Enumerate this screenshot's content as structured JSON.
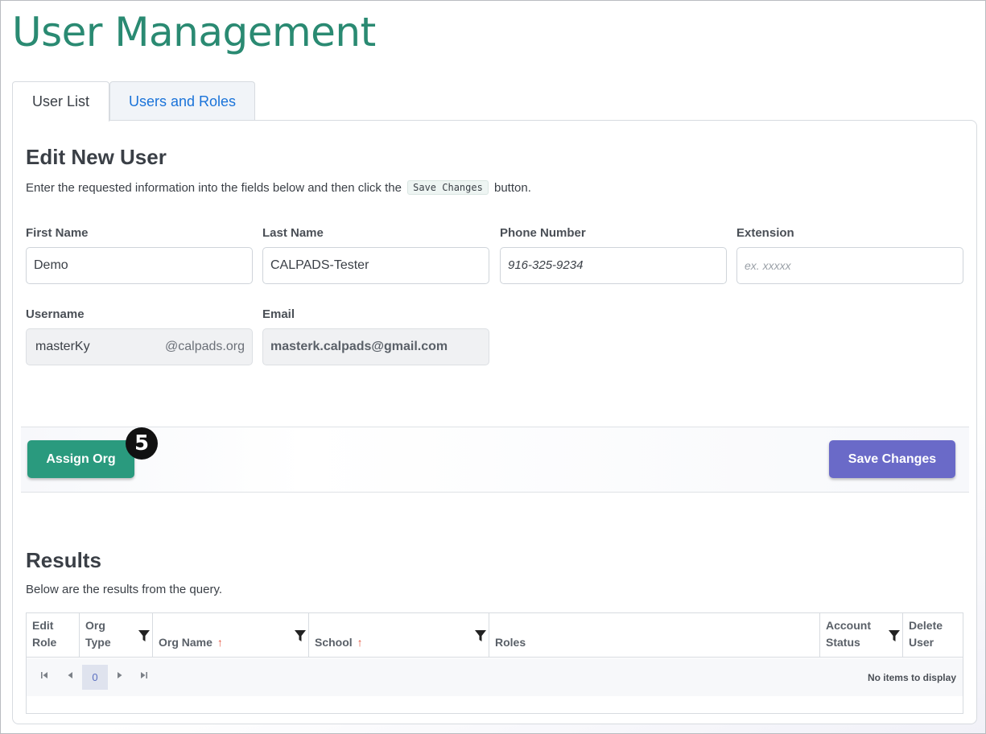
{
  "page": {
    "title": "User Management"
  },
  "tabs": [
    {
      "label": "User List",
      "active": true
    },
    {
      "label": "Users and Roles",
      "active": false
    }
  ],
  "edit": {
    "title": "Edit New User",
    "desc_before": "Enter the requested information into the fields below and then click the",
    "desc_code": "Save Changes",
    "desc_after": "button.",
    "fields": {
      "first_name": {
        "label": "First Name",
        "value": "Demo"
      },
      "last_name": {
        "label": "Last Name",
        "value": "CALPADS-Tester"
      },
      "phone": {
        "label": "Phone Number",
        "value": "916-325-9234"
      },
      "extension": {
        "label": "Extension",
        "placeholder": "ex. xxxxx"
      },
      "username": {
        "label": "Username",
        "value": "masterKy",
        "suffix": "@calpads.org"
      },
      "email": {
        "label": "Email",
        "value": "masterk.calpads@gmail.com"
      }
    }
  },
  "actions": {
    "assign_org": "Assign Org",
    "save_changes": "Save Changes",
    "step_badge": "5"
  },
  "results": {
    "title": "Results",
    "desc": "Below are the results from the query.",
    "columns": [
      {
        "line1": "Edit",
        "line2": "Role"
      },
      {
        "line1": "Org",
        "line2": "Type"
      },
      {
        "line1": "",
        "line2": "Org Name",
        "sort": "↑"
      },
      {
        "line1": "",
        "line2": "School",
        "sort": "↑"
      },
      {
        "line1": "",
        "line2": "Roles"
      },
      {
        "line1": "Account",
        "line2": "Status"
      },
      {
        "line1": "Delete",
        "line2": "User"
      }
    ],
    "pager": {
      "current_page": "0",
      "empty_text": "No items to display"
    }
  },
  "colors": {
    "title_green": "#2a8a72",
    "assign_green": "#2a9a7e",
    "save_purple": "#6a6ac8",
    "link_blue": "#1a73d9",
    "sort_red": "#e4553f"
  }
}
